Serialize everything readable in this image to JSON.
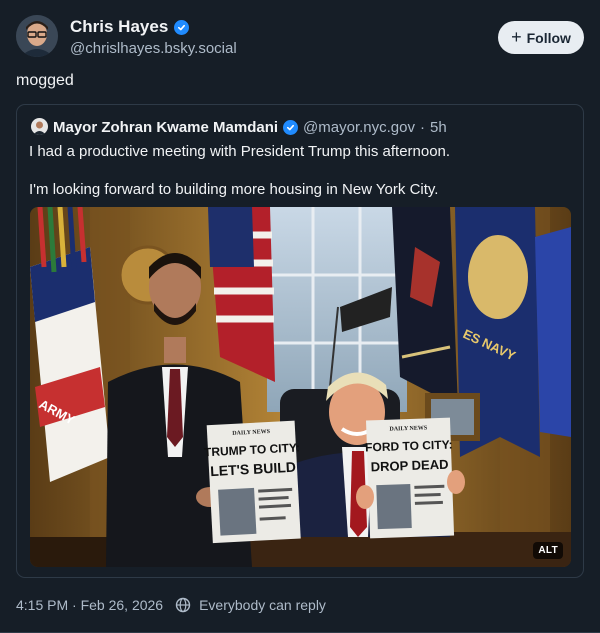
{
  "author": {
    "name": "Chris Hayes",
    "handle": "@chrislhayes.bsky.social",
    "avatar_icon": "avatar-photo",
    "verified_icon": "verified-check-icon"
  },
  "follow_button": {
    "label": "Follow",
    "icon": "plus-icon"
  },
  "post": {
    "text": "mogged"
  },
  "quote": {
    "author_name": "Mayor Zohran Kwame Mamdani",
    "handle": "@mayor.nyc.gov",
    "separator": "·",
    "time": "5h",
    "line1": "I had a productive meeting with President Trump this afternoon.",
    "line2": "I'm looking forward to building more housing in New York City.",
    "image": {
      "alt_badge": "ALT",
      "flag_banner_text": "ES NAVY",
      "army_banner_text": "ARMY",
      "sign_left": {
        "masthead": "DAILY NEWS",
        "headline_1": "TRUMP TO CITY:",
        "headline_2": "LET'S BUILD"
      },
      "sign_right": {
        "masthead": "DAILY NEWS",
        "headline_1": "FORD TO CITY:",
        "headline_2": "DROP DEAD"
      }
    }
  },
  "footer": {
    "timestamp": "4:15 PM · Feb 26, 2026",
    "reply_setting": "Everybody can reply",
    "reply_icon": "globe-icon"
  },
  "colors": {
    "background": "#161e27",
    "accent_verified": "#208bfe",
    "muted_text": "#aebbc9",
    "border": "#2e3a47"
  }
}
